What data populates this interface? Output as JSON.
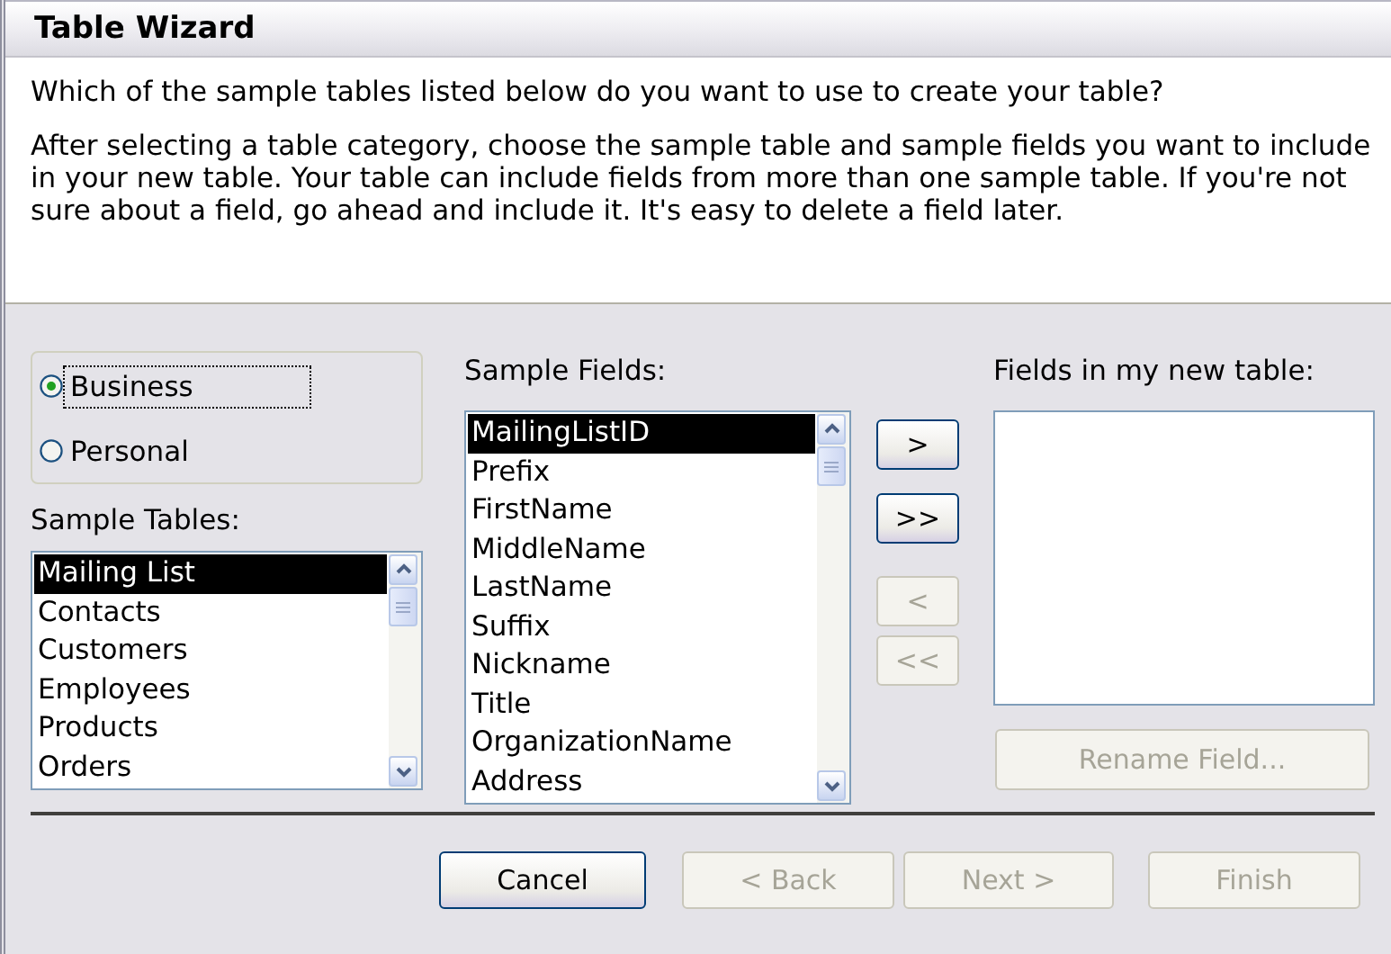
{
  "window": {
    "title": "Table Wizard"
  },
  "question": "Which of the sample tables listed below do you want to use to create your table?",
  "instructions": "After selecting a table category, choose the sample table and sample fields you want to include in your new table. Your table can include fields from more than one sample table. If you're not sure about a field, go ahead and include it. It's easy to delete a field later.",
  "category_options": [
    {
      "label": "Business",
      "selected": true,
      "focused": true
    },
    {
      "label": "Personal",
      "selected": false,
      "focused": false
    }
  ],
  "sample_tables": {
    "label": "Sample Tables:",
    "items": [
      {
        "label": "Mailing List",
        "selected": true
      },
      {
        "label": "Contacts",
        "selected": false
      },
      {
        "label": "Customers",
        "selected": false
      },
      {
        "label": "Employees",
        "selected": false
      },
      {
        "label": "Products",
        "selected": false
      },
      {
        "label": "Orders",
        "selected": false
      }
    ]
  },
  "sample_fields": {
    "label": "Sample Fields:",
    "items": [
      {
        "label": "MailingListID",
        "selected": true
      },
      {
        "label": "Prefix",
        "selected": false
      },
      {
        "label": "FirstName",
        "selected": false
      },
      {
        "label": "MiddleName",
        "selected": false
      },
      {
        "label": "LastName",
        "selected": false
      },
      {
        "label": "Suffix",
        "selected": false
      },
      {
        "label": "Nickname",
        "selected": false
      },
      {
        "label": "Title",
        "selected": false
      },
      {
        "label": "OrganizationName",
        "selected": false
      },
      {
        "label": "Address",
        "selected": false
      }
    ]
  },
  "move_buttons": [
    {
      "label": ">",
      "disabled": false
    },
    {
      "label": ">>",
      "disabled": false
    },
    {
      "label": "<",
      "disabled": true
    },
    {
      "label": "<<",
      "disabled": true
    }
  ],
  "new_table_fields": {
    "label": "Fields in my new table:"
  },
  "rename_button": {
    "label": "Rename Field...",
    "disabled": true
  },
  "footer_buttons": [
    {
      "label": "Cancel",
      "disabled": false
    },
    {
      "label": "< Back",
      "disabled": true
    },
    {
      "label": "Next >",
      "disabled": true
    },
    {
      "label": "Finish",
      "disabled": true
    }
  ]
}
